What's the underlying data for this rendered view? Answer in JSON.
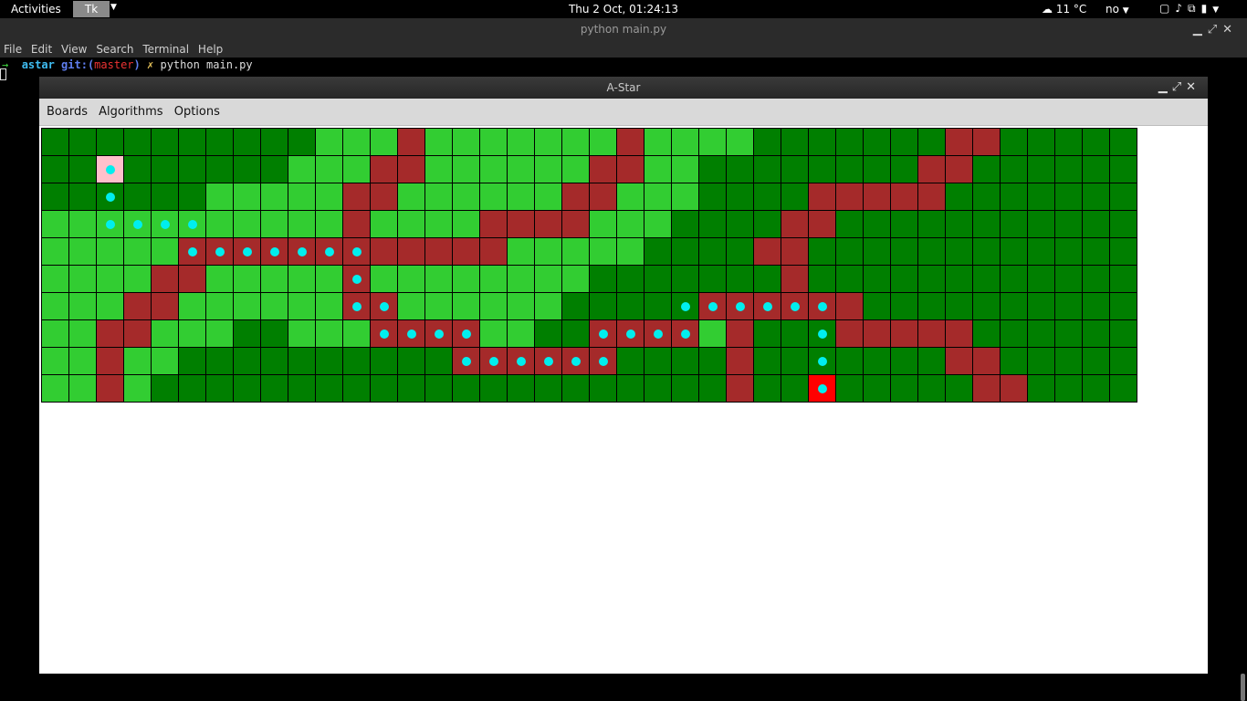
{
  "topbar": {
    "activities": "Activities",
    "app": "Tk",
    "clock": "Thu  2 Oct, 01:24:13",
    "weather": "11 °C",
    "keyboard": "no"
  },
  "terminal": {
    "title": "python main.py",
    "menu": [
      "File",
      "Edit",
      "View",
      "Search",
      "Terminal",
      "Help"
    ],
    "prompt": {
      "arrow": "→",
      "dir": "astar",
      "git": "git:(",
      "branch": "master",
      "git_close": ")",
      "mark": "✗",
      "command": "python main.py"
    }
  },
  "astar": {
    "title": "A-Star",
    "menu": [
      "Boards",
      "Algorithms",
      "Options"
    ]
  },
  "colors": {
    "D": "#007f00",
    "L": "#32cd32",
    "R": "#a52a2a",
    "P": "#ffc0cb",
    "E": "#ff0000"
  },
  "grid": {
    "rows": [
      "DDDDDDDDDDLLLRLLLLLLLRLLLLDDDDDDDRRDDDDD",
      "DDPDDDDDDLLLRRLLLLLLRRLLDDDDDDDDRRDDDDDD",
      "DDDDDDLLLLLRRLLLLLLRRLLLDDDDRRRRRDDDDDDD",
      "LLLLLLLLLLLRLLLLRRRRLLLDDDDRRDDDDDDDDDDD",
      "LLLLLRRRRRRRRRRRRLLLLLDDDDRRDDDDDDDDDDDD",
      "LLLLRRLLLLLRLLLLLLLLDDDDDDDRDDDDDDDDDDDD",
      "LLLRRLLLLLLRRLLLLLLDDDDDRRRRRRDDDDDDDDDD",
      "LLRRLLLDDLLLRRRRLLDDRRRRLRDDDRRRRRDDDDDD",
      "LLRLLDDDDDDDDDDRRRRRRDDDDRDDDDDDDRRDDDDD",
      "LLRLDDDDDDDDDDDDDDDDDDDDDRDDEDDDDDRRDDDD"
    ],
    "path": [
      [
        1,
        2
      ],
      [
        2,
        2
      ],
      [
        3,
        2
      ],
      [
        3,
        3
      ],
      [
        3,
        4
      ],
      [
        3,
        5
      ],
      [
        4,
        5
      ],
      [
        4,
        6
      ],
      [
        4,
        7
      ],
      [
        4,
        8
      ],
      [
        4,
        9
      ],
      [
        4,
        10
      ],
      [
        4,
        11
      ],
      [
        5,
        11
      ],
      [
        6,
        11
      ],
      [
        6,
        12
      ],
      [
        7,
        12
      ],
      [
        7,
        13
      ],
      [
        7,
        14
      ],
      [
        7,
        15
      ],
      [
        8,
        15
      ],
      [
        8,
        16
      ],
      [
        8,
        17
      ],
      [
        8,
        18
      ],
      [
        8,
        19
      ],
      [
        8,
        20
      ],
      [
        7,
        20
      ],
      [
        7,
        21
      ],
      [
        7,
        22
      ],
      [
        7,
        23
      ],
      [
        6,
        23
      ],
      [
        6,
        24
      ],
      [
        6,
        25
      ],
      [
        6,
        26
      ],
      [
        6,
        27
      ],
      [
        6,
        28
      ],
      [
        7,
        28
      ],
      [
        8,
        28
      ],
      [
        9,
        28
      ]
    ]
  }
}
